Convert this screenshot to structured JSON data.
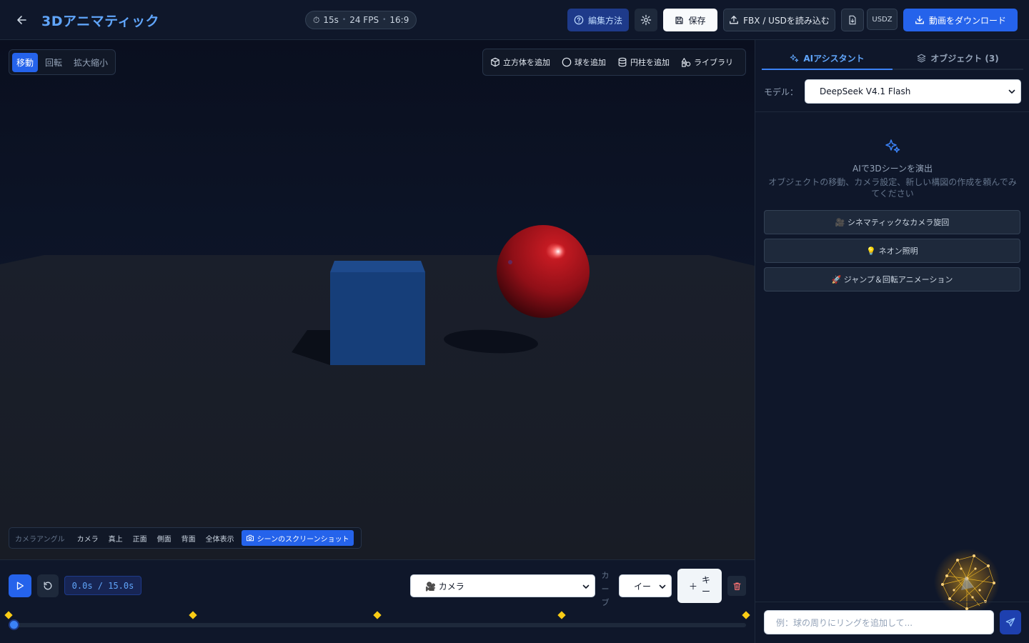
{
  "header": {
    "title": "3Dアニマティック",
    "duration": "15s",
    "fps": "24 FPS",
    "aspect": "16:9",
    "help_label": "編集方法",
    "save_label": "保存",
    "import_label": "FBX / USDを読み込む",
    "usdz_label": "USDZ",
    "download_label": "動画をダウンロード"
  },
  "viewport": {
    "transform_modes": [
      "移動",
      "回転",
      "拡大縮小"
    ],
    "active_mode": "移動",
    "add_items": {
      "cube": "立方体を追加",
      "sphere": "球を追加",
      "cylinder": "円柱を追加",
      "library": "ライブラリ"
    },
    "camera_angles": {
      "label": "カメラアングル",
      "camera": "カメラ",
      "top": "真上",
      "front": "正面",
      "side": "側面",
      "back": "背面",
      "fit": "全体表示",
      "screenshot": "シーンのスクリーンショット"
    },
    "colors": {
      "cube": "#1e4a8c",
      "sphere": "#a6111a",
      "floor": "#1b202b"
    }
  },
  "timeline": {
    "time": "0.0s / 15.0s",
    "object_select": "🎥 カメラ",
    "curve_label": "カーブ",
    "easing_select": "イー",
    "add_key_plus": "＋",
    "add_key_text_1": "キ",
    "add_key_text_2": "ー",
    "keyframes_sec": [
      0,
      3.75,
      7.5,
      11.25,
      15
    ],
    "current_sec": 0,
    "total_sec": 15
  },
  "panel": {
    "tabs": {
      "ai": "AIアシスタント",
      "objects": "オブジェクト (3)"
    },
    "model_label": "モデル：",
    "model_value": "DeepSeek V4.1 Flash",
    "empty_title": "AIで3Dシーンを演出",
    "empty_desc": "オブジェクトの移動、カメラ設定、新しい構図の作成を頼んでみてください",
    "suggestions": [
      "🎥 シネマティックなカメラ旋回",
      "💡 ネオン照明",
      "🚀 ジャンプ＆回転アニメーション"
    ],
    "chat_placeholder": "例：球の周りにリングを追加して..."
  }
}
